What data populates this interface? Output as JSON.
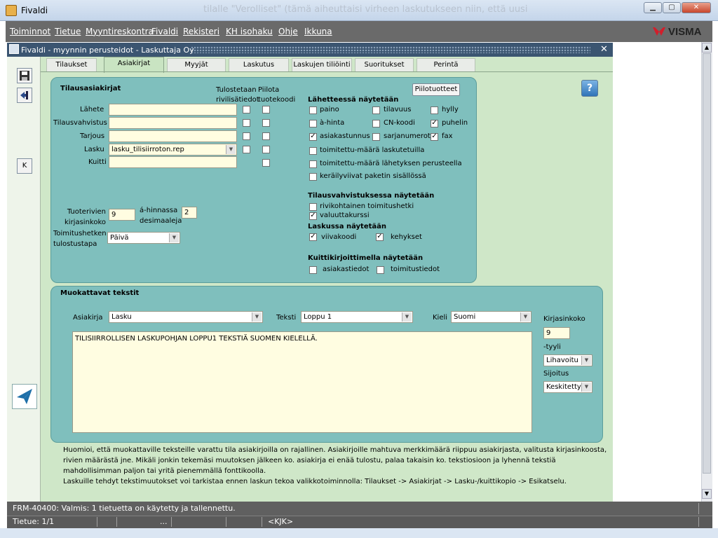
{
  "window": {
    "title": "Fivaldi",
    "ghost_text": "tilalle \"Verolliset\" (tämä aiheuttaisi virheen laskutukseen niin, että uusi"
  },
  "menu": [
    "Toiminnot",
    "Tietue",
    "Myyntireskontra",
    "Fivaldi",
    "Rekisteri",
    "KH isohaku",
    "Ohje",
    "Ikkuna"
  ],
  "brand": "VISMA",
  "inner": {
    "title": "Fivaldi - myynnin perusteidot - Laskuttaja Oy"
  },
  "left_toolbar": {
    "k_label": "K"
  },
  "tabs": [
    "Tilaukset",
    "Asiakirjat",
    "Myyjät",
    "Laskutus",
    "Laskujen tiliöinti",
    "Suoritukset",
    "Perintä"
  ],
  "active_tab": "Asiakirjat",
  "docs": {
    "section_title": "Tilausasiakirjat",
    "col_print": "Tulostetaan rivilisätiedot",
    "col_print_l1": "Tulostetaan",
    "col_print_l2": "rivilisätiedot",
    "col_hide_l1": "Piilota",
    "col_hide_l2": "tuotekoodi",
    "rows": [
      {
        "label": "Lähete",
        "value": "",
        "print": false,
        "hide": false
      },
      {
        "label": "Tilausvahvistus",
        "value": "",
        "print": false,
        "hide": false
      },
      {
        "label": "Tarjous",
        "value": "",
        "print": false,
        "hide": false
      },
      {
        "label": "Lasku",
        "value": "lasku_tilisiirroton.rep",
        "print": false,
        "hide": false
      },
      {
        "label": "Kuitti",
        "value": "",
        "hide": false
      }
    ],
    "font_size_l1": "Tuoterivien",
    "font_size_l2": "kirjasinkoko",
    "font_size_value": "9",
    "decimals_l1": "á-hinnassa",
    "decimals_l2": "desimaaleja",
    "decimals_value": "2",
    "delivery_l1": "Toimitushetken",
    "delivery_l2": "tulostustapa",
    "delivery_value": "Päivä",
    "hidden_products_button": "Piilotuotteet"
  },
  "delivery_note": {
    "title": "Lähetteessä näytetään",
    "items": [
      {
        "label": "paino",
        "checked": false
      },
      {
        "label": "tilavuus",
        "checked": false
      },
      {
        "label": "hylly",
        "checked": false
      },
      {
        "label": "à-hinta",
        "checked": false
      },
      {
        "label": "CN-koodi",
        "checked": false
      },
      {
        "label": "puhelin",
        "checked": true
      },
      {
        "label": "asiakastunnus",
        "checked": true
      },
      {
        "label": "sarjanumerot",
        "checked": false
      },
      {
        "label": "fax",
        "checked": true
      },
      {
        "label": "toimitettu-määrä laskutetuilla",
        "checked": false
      },
      {
        "label": "toimitettu-määrä lähetyksen perusteella",
        "checked": false
      },
      {
        "label": "keräilyviivat paketin sisällössä",
        "checked": false
      }
    ]
  },
  "order_confirmation": {
    "title": "Tilausvahvistuksessa näytetään",
    "items": [
      {
        "label": "rivikohtainen toimitushetki",
        "checked": false
      },
      {
        "label": "valuuttakurssi",
        "checked": true
      }
    ]
  },
  "invoice": {
    "title": "Laskussa näytetään",
    "items": [
      {
        "label": "viivakoodi",
        "checked": true
      },
      {
        "label": "kehykset",
        "checked": true
      }
    ]
  },
  "receipt_printer": {
    "title": "Kuittikirjoittimella näytetään",
    "items": [
      {
        "label": "asiakastiedot",
        "checked": false
      },
      {
        "label": "toimitustiedot",
        "checked": false
      }
    ]
  },
  "editable": {
    "title": "Muokattavat tekstit",
    "doc_label": "Asiakirja",
    "doc_value": "Lasku",
    "text_label": "Teksti",
    "text_value": "Loppu 1",
    "lang_label": "Kieli",
    "lang_value": "Suomi",
    "body": "TILISIIRROLLISEN LASKUPOHJAN LOPPU1 TEKSTIÄ SUOMEN KIELELLÄ.",
    "font_size_label": "Kirjasinkoko",
    "font_size_value": "9",
    "style_label": "-tyyli",
    "style_value": "Lihavoitu",
    "position_label": "Sijoitus",
    "position_value": "Keskitetty"
  },
  "notes": [
    "Huomioi, että muokattaville teksteille varattu tila asiakirjoilla on rajallinen. Asiakirjoille mahtuva merkkimäärä riippuu asiakirjasta, valitusta kirjasinkoosta,",
    "rivien määrästä jne. Mikäli jonkin tekemäsi muutoksen jälkeen ko. asiakirja ei enää tulostu, palaa takaisin ko. tekstiosioon ja lyhennä tekstiä",
    "mahdollisimman paljon tai yritä pienemmällä fonttikoolla.",
    "Laskuille tehdyt tekstimuutokset voi tarkistaa ennen laskun tekoa valikkotoiminnolla: Tilaukset -> Asiakirjat -> Lasku-/kuittikopio -> Esikatselu."
  ],
  "status": {
    "message": "FRM-40400: Valmis: 1 tietuetta on käytetty ja tallennettu.",
    "record": "Tietue: 1/1",
    "ellipsis": "...",
    "kjk": "<KJK>"
  }
}
